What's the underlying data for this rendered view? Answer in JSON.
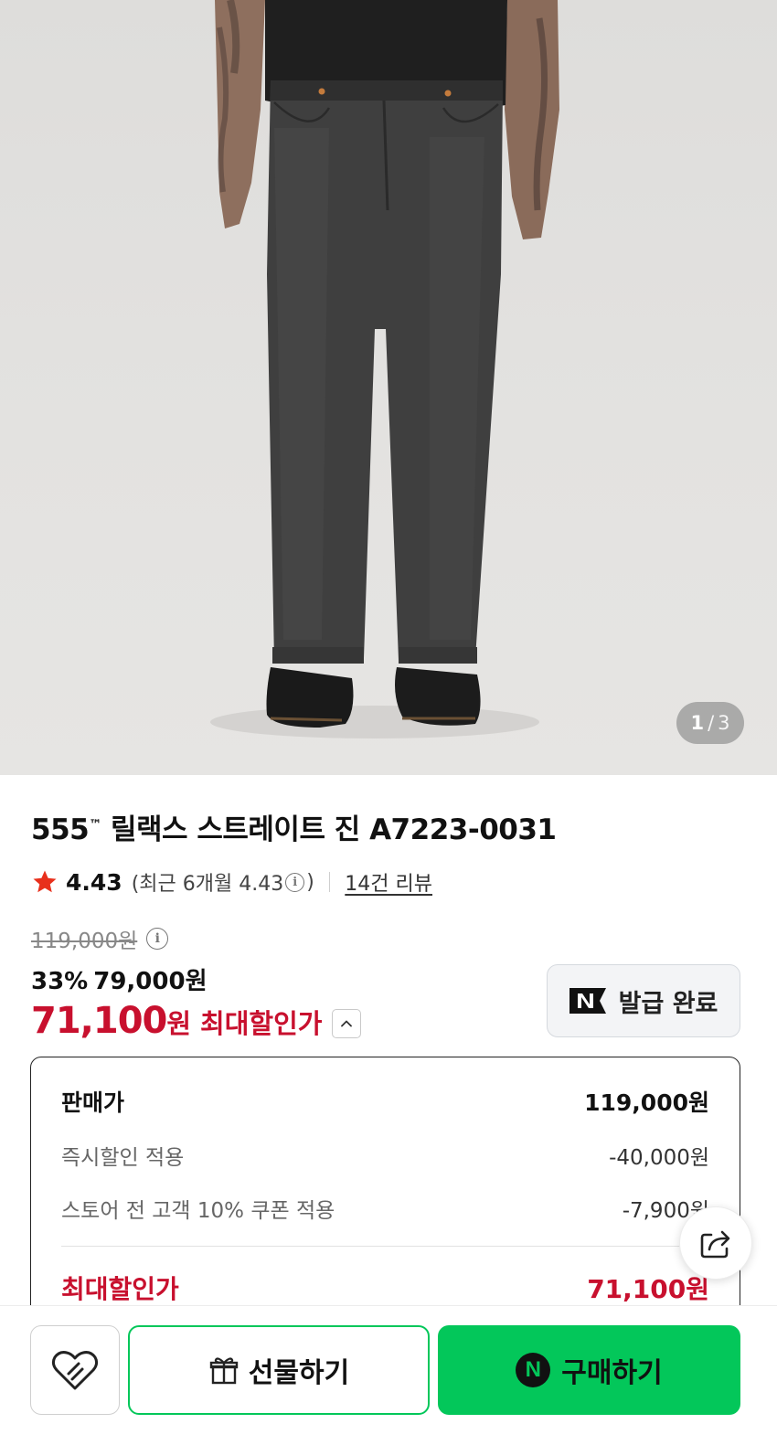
{
  "gallery": {
    "current": "1",
    "separator": "/",
    "total": "3"
  },
  "product": {
    "title_main": "555",
    "title_tm": "™",
    "title_rest": " 릴랙스 스트레이트 진 A7223-0031"
  },
  "rating": {
    "score": "4.43",
    "recent_label": "(최근 6개월 4.43",
    "recent_close": ")",
    "reviews": "14건 리뷰"
  },
  "price": {
    "original": "119,000원",
    "discount_pct": "33%",
    "sale": "79,000원",
    "max_amount": "71,100",
    "max_won": "원",
    "max_label": "최대할인가"
  },
  "coupon": {
    "label": "발급 완료"
  },
  "breakdown": {
    "rows": [
      {
        "label": "판매가",
        "value": "119,000원"
      },
      {
        "label": "즉시할인 적용",
        "value": "-40,000원"
      },
      {
        "label": "스토어 전 고객 10% 쿠폰 적용",
        "value": "-7,900원"
      }
    ],
    "total": {
      "label": "최대할인가",
      "value": "71,100원"
    }
  },
  "actions": {
    "gift": "선물하기",
    "buy": "구매하기",
    "buy_badge": "N"
  },
  "colors": {
    "accent_red": "#c8102e",
    "naver_green": "#03c75a",
    "star": "#e8301c"
  },
  "icons": [
    "star-icon",
    "info-icon",
    "chevron-up-icon",
    "naver-n-icon",
    "share-icon",
    "heart-icon",
    "gift-icon"
  ]
}
